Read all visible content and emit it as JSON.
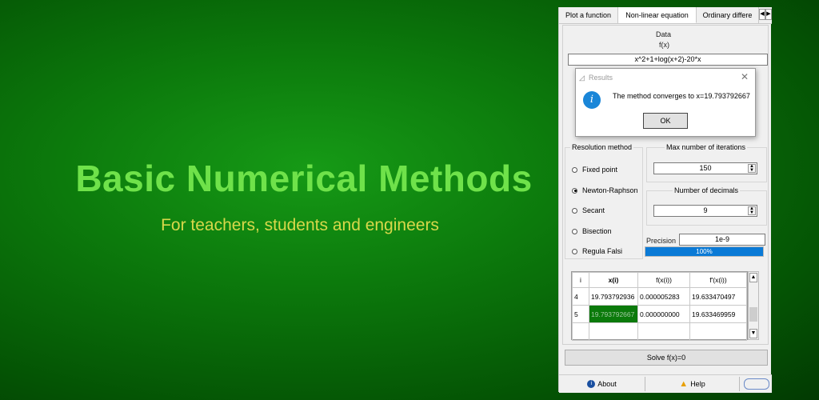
{
  "hero": {
    "title": "Basic Numerical Methods",
    "subtitle": "For teachers, students and engineers"
  },
  "tabs": [
    {
      "label": "Plot a function"
    },
    {
      "label": "Non-linear equation"
    },
    {
      "label": "Ordinary differe"
    }
  ],
  "data_section": {
    "title": "Data",
    "fx_label": "f(x)",
    "fx_value": "x^2+1+log(x+2)-20*x"
  },
  "resolution": {
    "title": "Resolution method",
    "options": [
      "Fixed point",
      "Newton-Raphson",
      "Secant",
      "Bisection",
      "Regula Falsi"
    ],
    "selected": "Newton-Raphson"
  },
  "max_iterations": {
    "title": "Max number of iterations",
    "value": "150"
  },
  "decimals": {
    "title": "Number of decimals",
    "value": "9"
  },
  "precision": {
    "label": "Precision",
    "value": "1e-9"
  },
  "progress": {
    "value": 100,
    "label": "100%"
  },
  "table": {
    "headers": [
      "i",
      "x(i)",
      "f(x(i))",
      "f'(x(i))"
    ],
    "rows": [
      [
        "4",
        "19.793792936",
        "0.000005283",
        "19.633470497"
      ],
      [
        "5",
        "19.793792667",
        "0.000000000",
        "19.633469959"
      ]
    ]
  },
  "solve_label": "Solve f(x)=0",
  "bottom": {
    "about": "About",
    "help": "Help"
  },
  "dialog": {
    "title": "Results",
    "message": "The method converges to x=19.793792667",
    "ok": "OK"
  },
  "colors": {
    "accent_green": "#6fe24a",
    "subtitle_yellow": "#d8d84a",
    "progress_blue": "#0a7ad6",
    "info_blue": "#1a86d8"
  }
}
